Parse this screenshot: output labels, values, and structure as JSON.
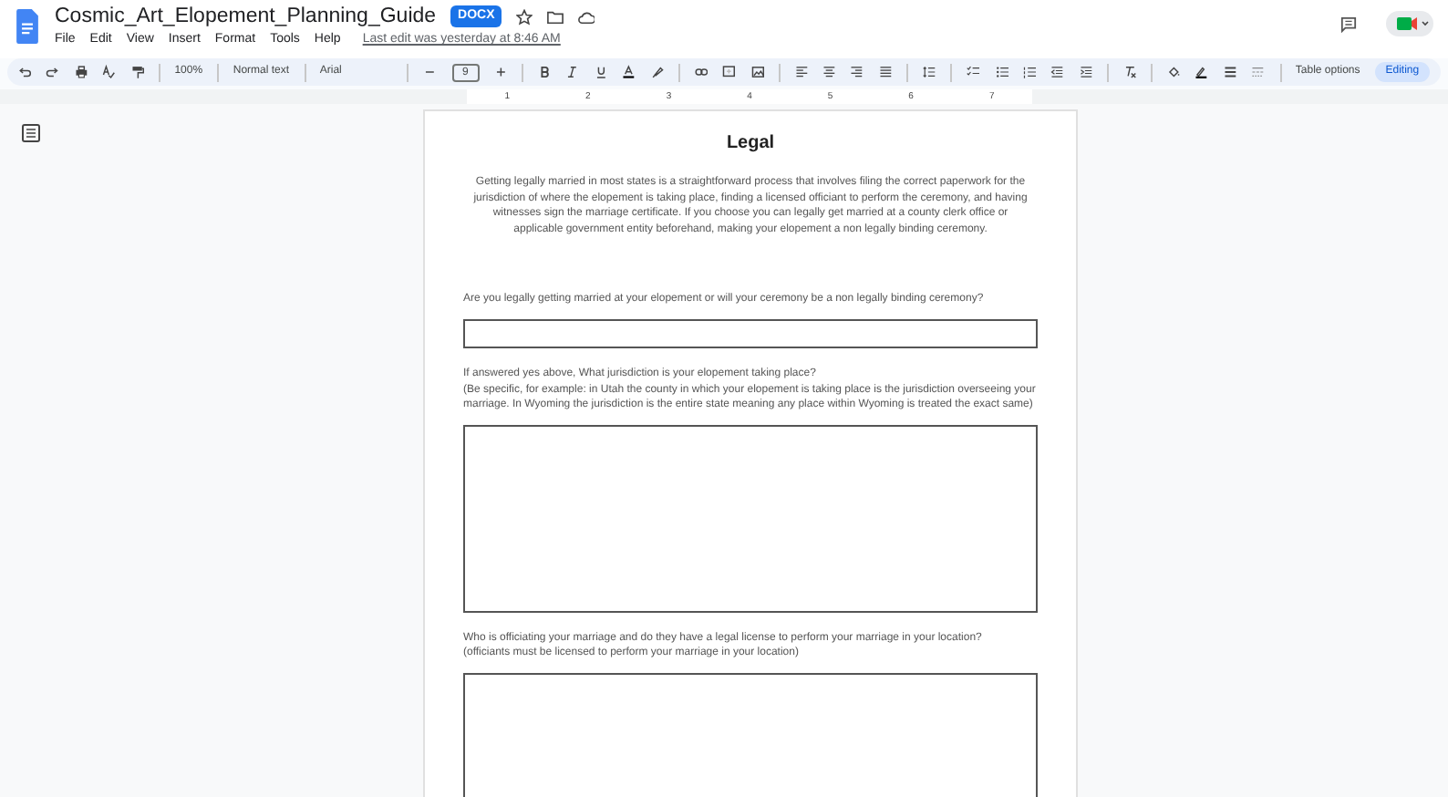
{
  "document": {
    "title": "Cosmic_Art_Elopement_Planning_Guide",
    "badge": "DOCX",
    "menu": [
      "File",
      "Edit",
      "View",
      "Insert",
      "Format",
      "Tools",
      "Help"
    ],
    "last_edit": "Last edit was yesterday at 8:46 AM"
  },
  "toolbar": {
    "zoom": "100%",
    "style": "Normal text",
    "font": "Arial",
    "size": "9",
    "table_options": "Table options",
    "mode": "Editing"
  },
  "ruler": {
    "labels": [
      "1",
      "2",
      "3",
      "4",
      "5",
      "6",
      "7"
    ]
  },
  "page": {
    "heading": "Legal",
    "intro": "Getting legally married in most states is a straightforward process that involves filing the correct paperwork for the jurisdiction of where the elopement is taking place, finding a licensed officiant to perform the ceremony, and having witnesses sign the marriage certificate. If you choose you can legally get married at a county clerk office or applicable government entity beforehand, making your elopement a non legally binding ceremony.",
    "questions": [
      {
        "lines": [
          "Are you legally getting married at your elopement or will your ceremony be a non legally binding ceremony?"
        ],
        "kind": "short"
      },
      {
        "lines": [
          "If answered yes above, What jurisdiction is your elopement taking place?",
          "(Be specific, for example: in Utah the county in which your elopement is taking place is the jurisdiction overseeing your marriage. In Wyoming the jurisdiction is the entire state meaning any place within Wyoming is treated the exact same)"
        ],
        "kind": "long"
      },
      {
        "lines": [
          "Who is officiating your marriage and do they have a legal license to perform your marriage in your location?",
          "(officiants must be licensed to perform your marriage in your location)"
        ],
        "kind": "long"
      }
    ]
  }
}
